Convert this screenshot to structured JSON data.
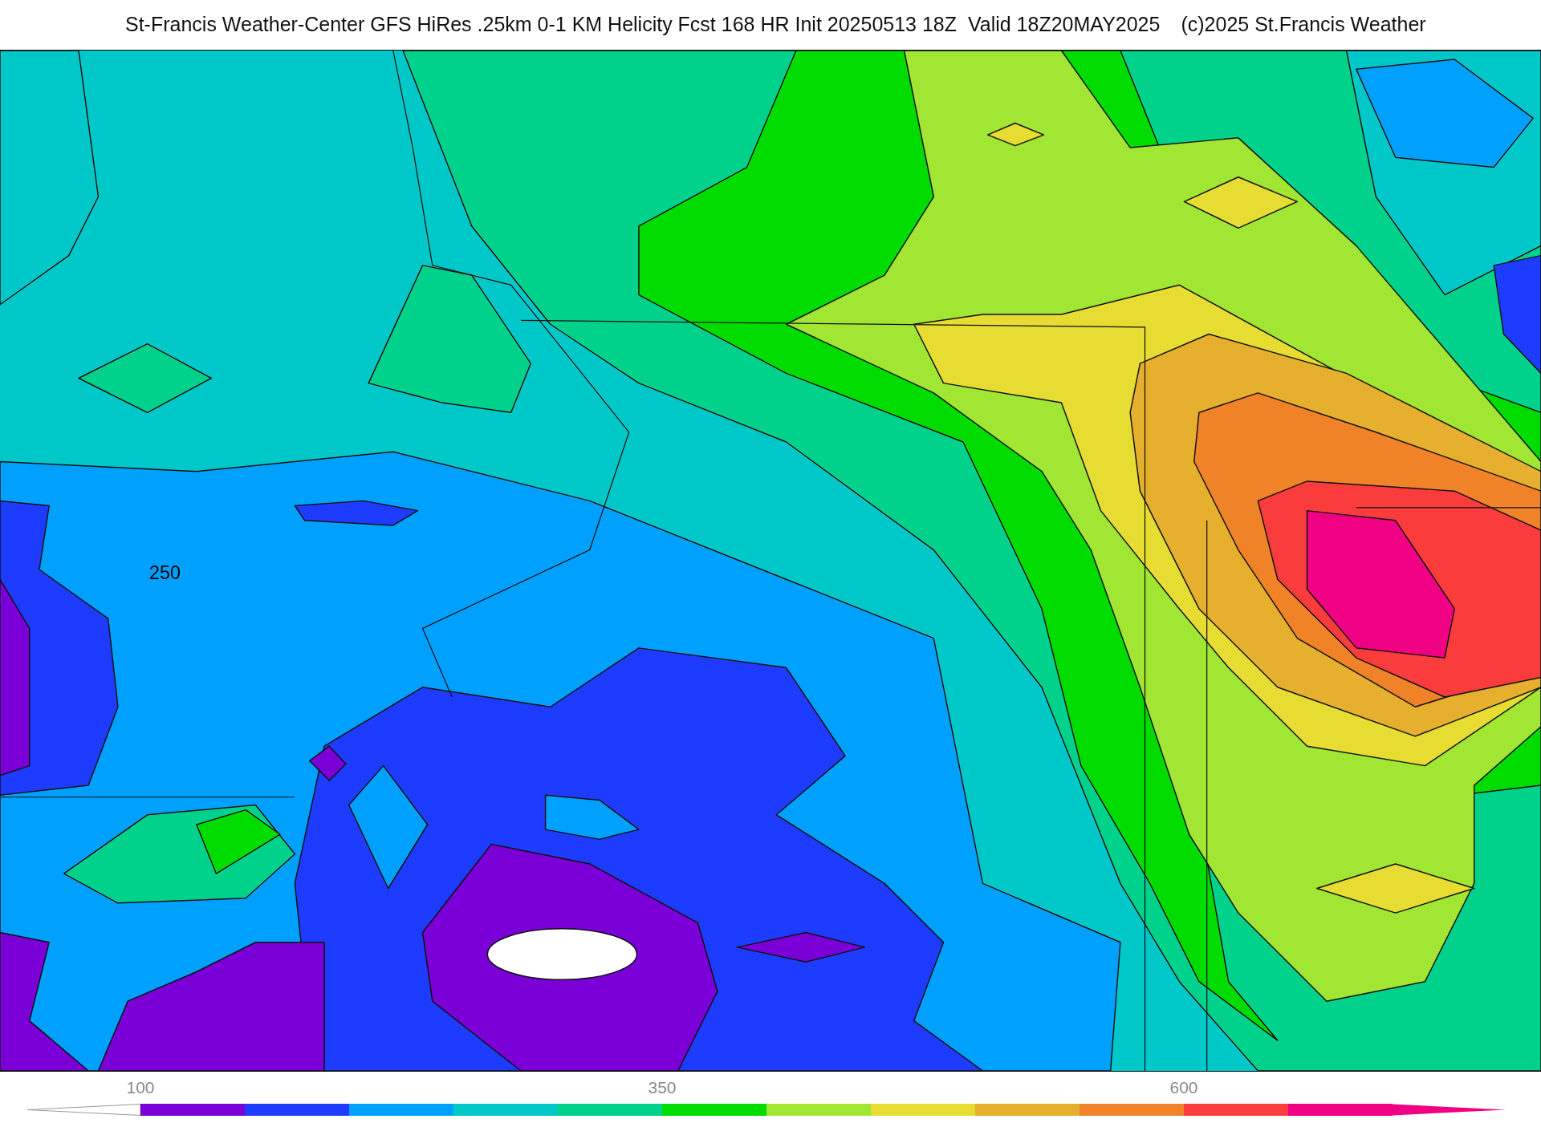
{
  "header": {
    "title": "St-Francis Weather-Center GFS HiRes .25km 0-1 KM Helicity Fcst 168 HR Init 20250513 18Z  Valid 18Z20MAY2025",
    "copyright": "(c)2025 St.Francis Weather"
  },
  "map": {
    "contour_labels": [
      "250"
    ]
  },
  "colorbar": {
    "segments": [
      {
        "color": "#7b00d8",
        "tick": "100"
      },
      {
        "color": "#1e3cff"
      },
      {
        "color": "#00a0ff"
      },
      {
        "color": "#00c8c8"
      },
      {
        "color": "#00d28c"
      },
      {
        "color": "#00dc00",
        "tick": "350"
      },
      {
        "color": "#a0e632"
      },
      {
        "color": "#e6dc32"
      },
      {
        "color": "#e6af2d"
      },
      {
        "color": "#f08228"
      },
      {
        "color": "#fa3c3c",
        "tick": "600"
      },
      {
        "color": "#f00082"
      }
    ]
  }
}
